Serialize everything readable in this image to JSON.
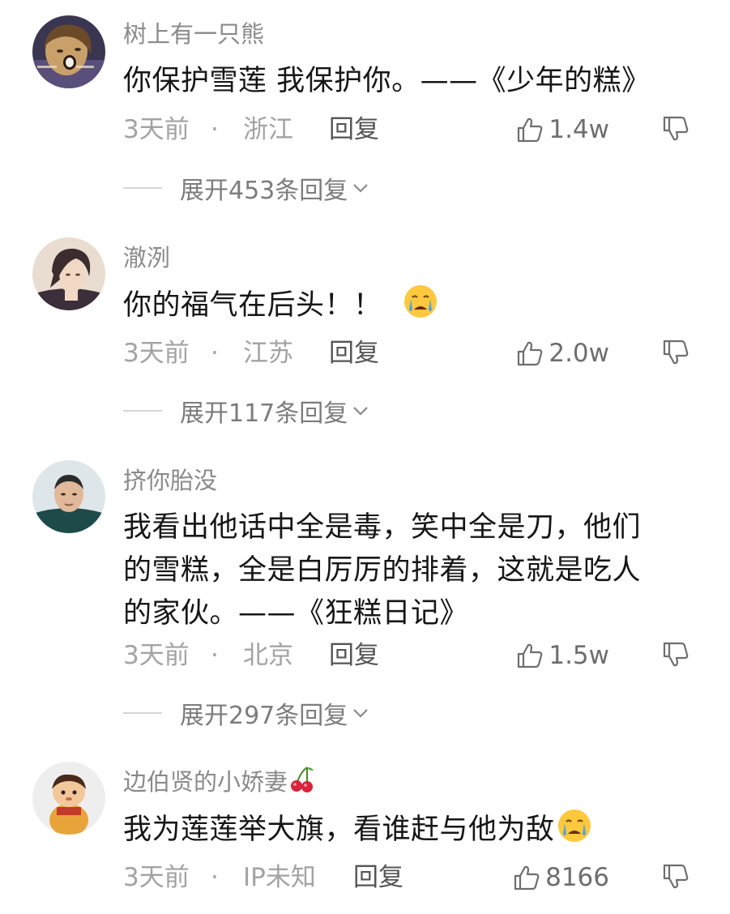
{
  "comments": [
    {
      "username": "树上有一只熊",
      "content": "你保护雪莲  我保护你。——《少年的糕》",
      "time": "3天前",
      "separator": "·",
      "location": "浙江",
      "reply_label": "回复",
      "likes": "1.4w",
      "expand_label": "展开453条回复"
    },
    {
      "username": "澈洌",
      "content": "你的福气在后头！！",
      "content_emoji": "crying-face-emoji",
      "time": "3天前",
      "separator": "·",
      "location": "江苏",
      "reply_label": "回复",
      "likes": "2.0w",
      "expand_label": "展开117条回复"
    },
    {
      "username": "挤你胎没",
      "content_lines": [
        "我看出他话中全是毒，笑中全是刀，他们",
        "的雪糕，全是白厉厉的排着，这就是吃人",
        "的家伙。——《狂糕日记》"
      ],
      "time": "3天前",
      "separator": "·",
      "location": "北京",
      "reply_label": "回复",
      "likes": "1.5w",
      "expand_label": "展开297条回复"
    },
    {
      "username": "边伯贤的小娇妻",
      "username_emoji": "cherry-emoji",
      "content": "我为莲莲举大旗，看谁赶与他为敌",
      "content_emoji": "crying-face-emoji",
      "time": "3天前",
      "separator": "·",
      "location": "IP未知",
      "reply_label": "回复",
      "likes": "8166"
    }
  ],
  "icons": {
    "like": "thumbs-up-outline-icon",
    "dislike": "thumbs-down-outline-icon",
    "expand": "chevron-down-icon"
  },
  "colors": {
    "username": "#8a8a8a",
    "content": "#161616",
    "meta": "#a3a3a3",
    "reply": "#555555",
    "like": "#6e6e6e"
  }
}
